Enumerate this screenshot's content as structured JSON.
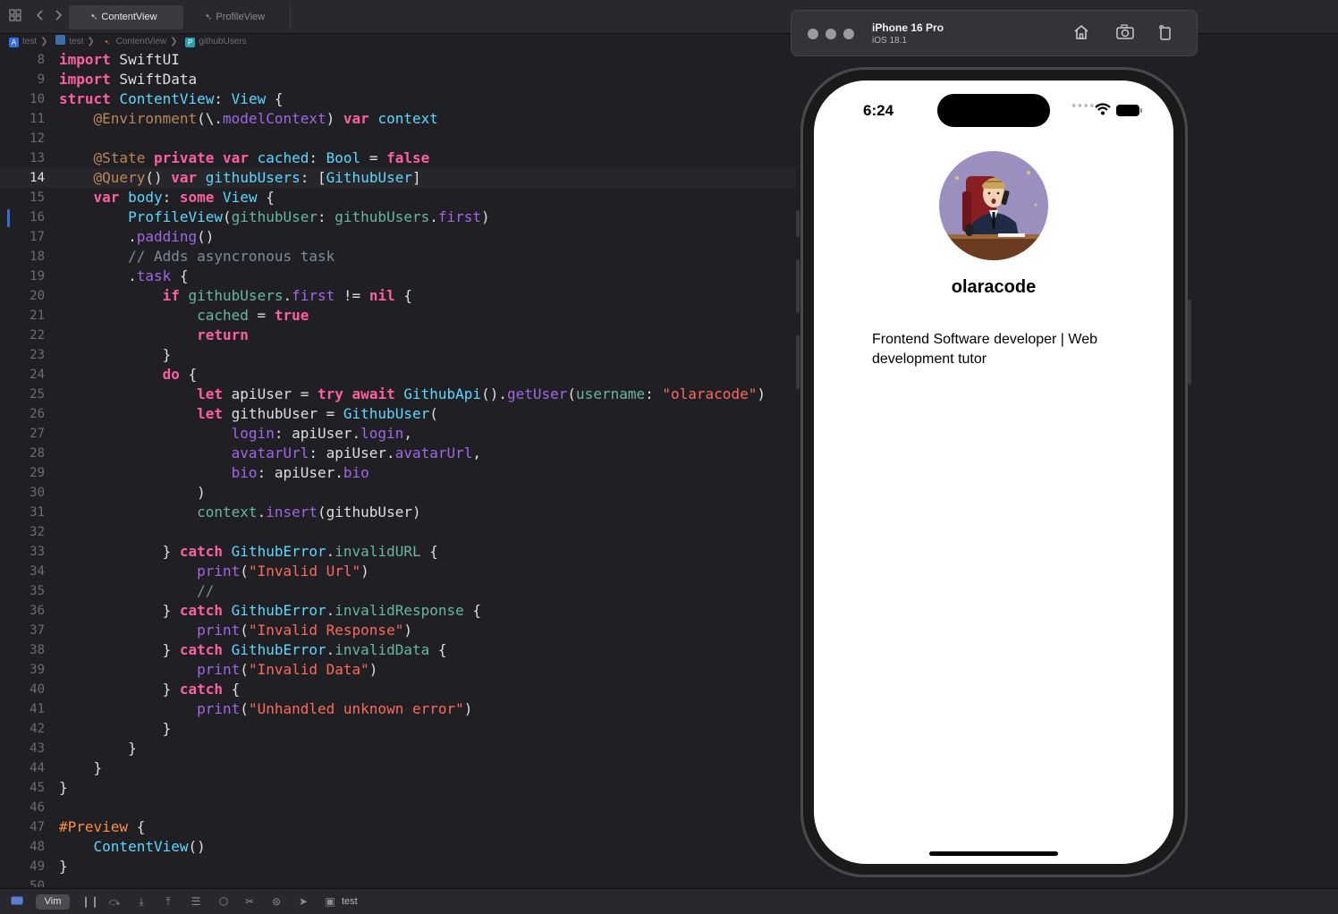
{
  "tabs": [
    {
      "label": "ContentView",
      "active": true
    },
    {
      "label": "ProfileView",
      "active": false
    }
  ],
  "breadcrumb": [
    "test",
    "test",
    "ContentView",
    "githubUsers"
  ],
  "editor": {
    "current_line": 14,
    "lines": [
      {
        "n": "8",
        "html": "<span class=\"kw\">import</span> SwiftUI"
      },
      {
        "n": "9",
        "html": "<span class=\"kw\">import</span> SwiftData"
      },
      {
        "n": "10",
        "html": "<span class=\"kw\">struct</span> <span class=\"ty\">ContentView</span>: <span class=\"ty\">View</span> {"
      },
      {
        "n": "11",
        "html": "    <span class=\"at\">@Environment</span>(\\.<span class=\"pr\">modelContext</span>) <span class=\"kw\">var</span> <span class=\"ty\">context</span>"
      },
      {
        "n": "12",
        "html": ""
      },
      {
        "n": "13",
        "html": "    <span class=\"at\">@State</span> <span class=\"kw\">private</span> <span class=\"kw\">var</span> <span class=\"ty\">cached</span>: <span class=\"ty\">Bool</span> = <span class=\"kw\">false</span>"
      },
      {
        "n": "14",
        "html": "    <span class=\"at\">@Query</span>() <span class=\"kw\">var</span> <span class=\"ty\">githubUsers</span>: [<span class=\"ty\">GithubUser</span>]"
      },
      {
        "n": "15",
        "html": "    <span class=\"kw\">var</span> <span class=\"ty\">body</span>: <span class=\"kw\">some</span> <span class=\"ty\">View</span> {"
      },
      {
        "n": "16",
        "html": "        <span class=\"ty\">ProfileView</span>(<span class=\"fn\">githubUser</span>: <span class=\"fn\">githubUsers</span>.<span class=\"pr\">first</span>)"
      },
      {
        "n": "17",
        "html": "        .<span class=\"pr\">padding</span>()"
      },
      {
        "n": "18",
        "html": "        <span class=\"cm\">// Adds asyncronous task</span>"
      },
      {
        "n": "19",
        "html": "        .<span class=\"pr\">task</span> {"
      },
      {
        "n": "20",
        "html": "            <span class=\"kw\">if</span> <span class=\"fn\">githubUsers</span>.<span class=\"pr\">first</span> != <span class=\"kw\">nil</span> {"
      },
      {
        "n": "21",
        "html": "                <span class=\"fn\">cached</span> = <span class=\"kw\">true</span>"
      },
      {
        "n": "22",
        "html": "                <span class=\"kw\">return</span>"
      },
      {
        "n": "23",
        "html": "            }"
      },
      {
        "n": "24",
        "html": "            <span class=\"kw\">do</span> {"
      },
      {
        "n": "25",
        "html": "                <span class=\"kw\">let</span> apiUser = <span class=\"kw\">try</span> <span class=\"kw\">await</span> <span class=\"ty\">GithubApi</span>().<span class=\"pr\">getUser</span>(<span class=\"fn\">username</span>: <span class=\"st\">\"olaracode\"</span>)"
      },
      {
        "n": "26",
        "html": "                <span class=\"kw\">let</span> githubUser = <span class=\"ty\">GithubUser</span>("
      },
      {
        "n": "27",
        "html": "                    <span class=\"pr\">login</span>: apiUser.<span class=\"pr\">login</span>,"
      },
      {
        "n": "28",
        "html": "                    <span class=\"pr\">avatarUrl</span>: apiUser.<span class=\"pr\">avatarUrl</span>,"
      },
      {
        "n": "29",
        "html": "                    <span class=\"pr\">bio</span>: apiUser.<span class=\"pr\">bio</span>"
      },
      {
        "n": "30",
        "html": "                )"
      },
      {
        "n": "31",
        "html": "                <span class=\"fn\">context</span>.<span class=\"pr\">insert</span>(githubUser)"
      },
      {
        "n": "32",
        "html": ""
      },
      {
        "n": "33",
        "html": "            } <span class=\"kw\">catch</span> <span class=\"ty\">GithubError</span>.<span class=\"fn\">invalidURL</span> {"
      },
      {
        "n": "34",
        "html": "                <span class=\"pr\">print</span>(<span class=\"st\">\"Invalid Url\"</span>)"
      },
      {
        "n": "35",
        "html": "                <span class=\"cm\">//</span>"
      },
      {
        "n": "36",
        "html": "            } <span class=\"kw\">catch</span> <span class=\"ty\">GithubError</span>.<span class=\"fn\">invalidResponse</span> {"
      },
      {
        "n": "37",
        "html": "                <span class=\"pr\">print</span>(<span class=\"st\">\"Invalid Response\"</span>)"
      },
      {
        "n": "38",
        "html": "            } <span class=\"kw\">catch</span> <span class=\"ty\">GithubError</span>.<span class=\"fn\">invalidData</span> {"
      },
      {
        "n": "39",
        "html": "                <span class=\"pr\">print</span>(<span class=\"st\">\"Invalid Data\"</span>)"
      },
      {
        "n": "40",
        "html": "            } <span class=\"kw\">catch</span> {"
      },
      {
        "n": "41",
        "html": "                <span class=\"pr\">print</span>(<span class=\"st\">\"Unhandled unknown error\"</span>)"
      },
      {
        "n": "42",
        "html": "            }"
      },
      {
        "n": "43",
        "html": "        }"
      },
      {
        "n": "44",
        "html": "    }"
      },
      {
        "n": "45",
        "html": "}"
      },
      {
        "n": "46",
        "html": ""
      },
      {
        "n": "47",
        "html": "<span class=\"pp\">#Preview</span> {"
      },
      {
        "n": "48",
        "html": "    <span class=\"ty\">ContentView</span>()"
      },
      {
        "n": "49",
        "html": "}"
      },
      {
        "n": "50",
        "html": ""
      }
    ]
  },
  "simulator": {
    "device_name": "iPhone 16 Pro",
    "os_version": "iOS 18.1",
    "buttons": [
      "home-icon",
      "screenshot-icon",
      "rotate-icon"
    ]
  },
  "phone": {
    "time": "6:24",
    "username": "olaracode",
    "bio": "Frontend Software developer | Web development tutor"
  },
  "bottombar": {
    "mode": "Vim",
    "scheme": "test"
  }
}
